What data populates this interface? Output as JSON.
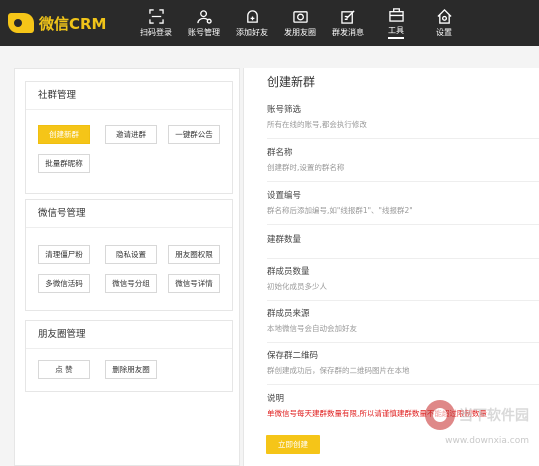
{
  "app": {
    "logo_text": "微信CRM"
  },
  "nav": [
    {
      "label": "扫码登录",
      "icon": "scan-login-icon"
    },
    {
      "label": "账号管理",
      "icon": "account-manage-icon"
    },
    {
      "label": "添加好友",
      "icon": "add-friend-icon"
    },
    {
      "label": "发朋友圈",
      "icon": "camera-icon"
    },
    {
      "label": "群发消息",
      "icon": "edit-message-icon"
    },
    {
      "label": "工具",
      "icon": "toolbox-icon",
      "active": true
    },
    {
      "label": "设置",
      "icon": "home-settings-icon"
    }
  ],
  "left": {
    "group1": {
      "title": "社群管理",
      "buttons": [
        "创建新群",
        "邀请进群",
        "一键群公告",
        "批量群昵称"
      ]
    },
    "group2": {
      "title": "微信号管理",
      "buttons": [
        "清理僵尸粉",
        "隐私设置",
        "朋友圈权限",
        "多微信活码",
        "微信号分组",
        "微信号详情"
      ]
    },
    "group3": {
      "title": "朋友圈管理",
      "buttons": [
        "点 赞",
        "删除朋友圈"
      ]
    }
  },
  "right": {
    "title": "创建新群",
    "fields": [
      {
        "label": "账号筛选",
        "desc": "所有在线的账号,都会执行修改"
      },
      {
        "label": "群名称",
        "desc": "创建群时,设置的群名称"
      },
      {
        "label": "设置编号",
        "desc": "群名称后添加编号,如\"线报群1\"、\"线报群2\""
      },
      {
        "label": "建群数量",
        "desc": ""
      },
      {
        "label": "群成员数量",
        "desc": "初始化成员多少人"
      },
      {
        "label": "群成员来源",
        "desc": "本地微信号会自动会加好友"
      },
      {
        "label": "保存群二维码",
        "desc": "群创建成功后，保存群的二维码图片在本地"
      },
      {
        "label": "说明",
        "desc": "单微信号每天建群数量有限,所以请谨慎建群数量不能超过限制数量"
      }
    ],
    "submit_label": "立即创建"
  },
  "watermark": {
    "text": "当下软件园",
    "url": "www.downxia.com"
  },
  "colors": {
    "accent": "#f5c518",
    "topbar": "#2a2a2a",
    "warning": "#e02020"
  }
}
